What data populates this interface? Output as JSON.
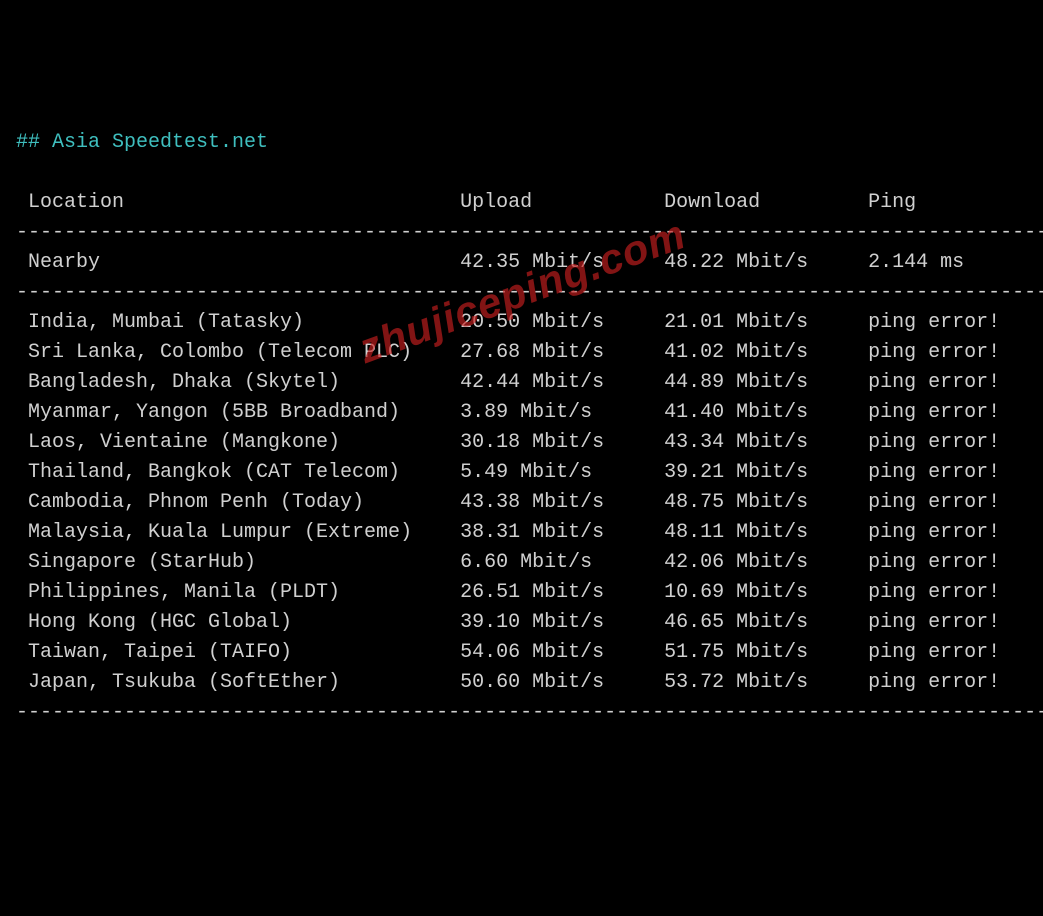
{
  "title": "## Asia Speedtest.net",
  "columns": {
    "location": "Location",
    "upload": "Upload",
    "download": "Download",
    "ping": "Ping"
  },
  "divider": "---------------------------------------------------------------------------------------",
  "nearby": {
    "location": "Nearby",
    "upload": "42.35 Mbit/s",
    "download": "48.22 Mbit/s",
    "ping": "2.144 ms"
  },
  "rows": [
    {
      "location": "India, Mumbai (Tatasky)",
      "upload": "20.50 Mbit/s",
      "download": "21.01 Mbit/s",
      "ping": "ping error!"
    },
    {
      "location": "Sri Lanka, Colombo (Telecom PLC)",
      "upload": "27.68 Mbit/s",
      "download": "41.02 Mbit/s",
      "ping": "ping error!"
    },
    {
      "location": "Bangladesh, Dhaka (Skytel)",
      "upload": "42.44 Mbit/s",
      "download": "44.89 Mbit/s",
      "ping": "ping error!"
    },
    {
      "location": "Myanmar, Yangon (5BB Broadband)",
      "upload": "3.89 Mbit/s",
      "download": "41.40 Mbit/s",
      "ping": "ping error!"
    },
    {
      "location": "Laos, Vientaine (Mangkone)",
      "upload": "30.18 Mbit/s",
      "download": "43.34 Mbit/s",
      "ping": "ping error!"
    },
    {
      "location": "Thailand, Bangkok (CAT Telecom)",
      "upload": "5.49 Mbit/s",
      "download": "39.21 Mbit/s",
      "ping": "ping error!"
    },
    {
      "location": "Cambodia, Phnom Penh (Today)",
      "upload": "43.38 Mbit/s",
      "download": "48.75 Mbit/s",
      "ping": "ping error!"
    },
    {
      "location": "Malaysia, Kuala Lumpur (Extreme)",
      "upload": "38.31 Mbit/s",
      "download": "48.11 Mbit/s",
      "ping": "ping error!"
    },
    {
      "location": "Singapore (StarHub)",
      "upload": "6.60 Mbit/s",
      "download": "42.06 Mbit/s",
      "ping": "ping error!"
    },
    {
      "location": "Philippines, Manila (PLDT)",
      "upload": "26.51 Mbit/s",
      "download": "10.69 Mbit/s",
      "ping": "ping error!"
    },
    {
      "location": "Hong Kong (HGC Global)",
      "upload": "39.10 Mbit/s",
      "download": "46.65 Mbit/s",
      "ping": "ping error!"
    },
    {
      "location": "Taiwan, Taipei (TAIFO)",
      "upload": "54.06 Mbit/s",
      "download": "51.75 Mbit/s",
      "ping": "ping error!"
    },
    {
      "location": "Japan, Tsukuba (SoftEther)",
      "upload": "50.60 Mbit/s",
      "download": "53.72 Mbit/s",
      "ping": "ping error!"
    }
  ],
  "layout": {
    "col1_start": 1,
    "col2_start": 37,
    "col3_start": 54,
    "col4_start": 71
  },
  "watermark": "zhujiceping.com"
}
